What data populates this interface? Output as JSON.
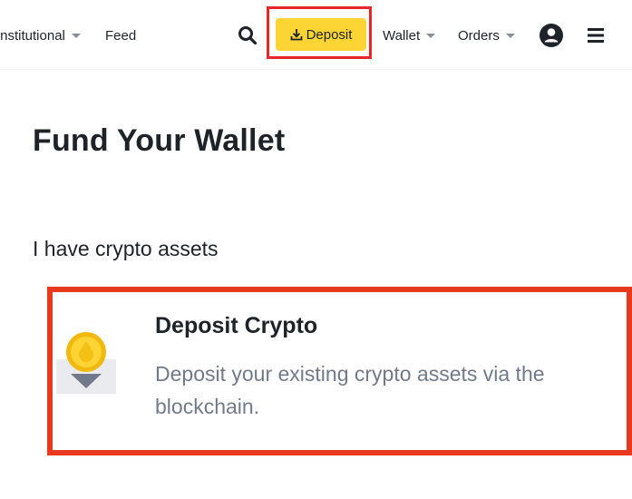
{
  "nav": {
    "institutional_label": "Institutional",
    "feed_label": "Feed",
    "deposit_label": "Deposit",
    "wallet_label": "Wallet",
    "orders_label": "Orders"
  },
  "main": {
    "title": "Fund Your Wallet",
    "section_label": "I have crypto assets",
    "card": {
      "title": "Deposit Crypto",
      "description": "Deposit your existing crypto assets via the blockchain.",
      "icon": "coin-deposit-icon"
    }
  },
  "colors": {
    "accent_yellow": "#fcd535",
    "highlight_red": "#e8262a",
    "text_primary": "#1e2329",
    "text_secondary": "#707a8a"
  },
  "icons": [
    "search-icon",
    "download-icon",
    "caret-down-icon",
    "account-icon",
    "menu-icon",
    "coin-deposit-icon"
  ]
}
